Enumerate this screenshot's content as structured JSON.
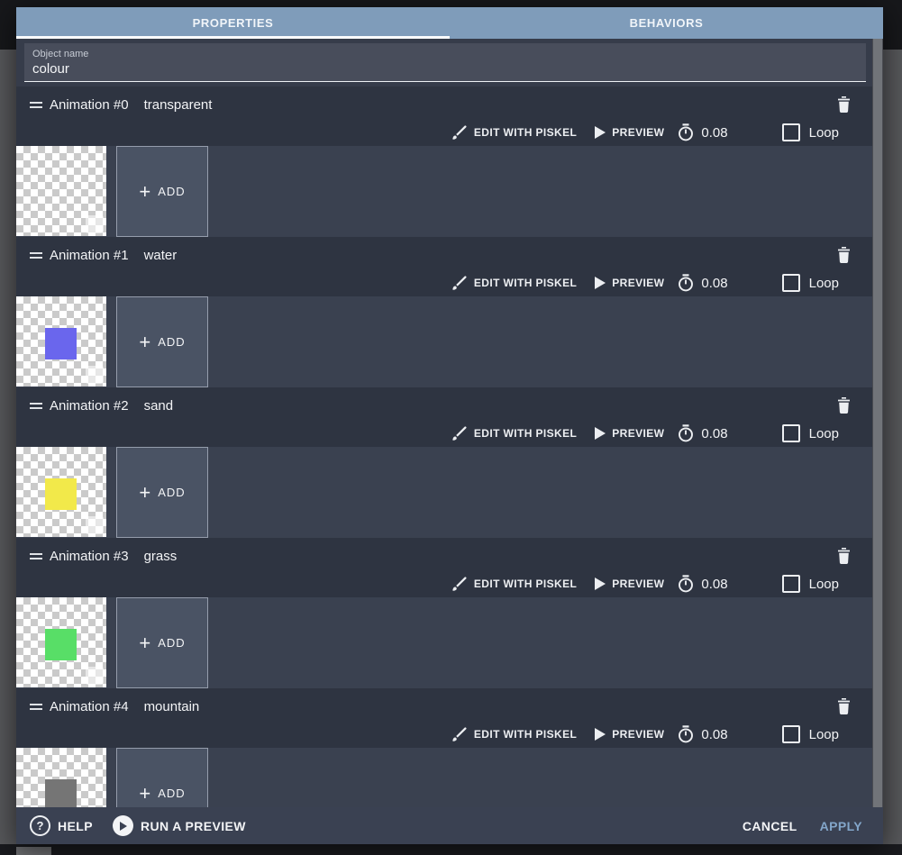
{
  "tabs": [
    {
      "label": "PROPERTIES",
      "active": true
    },
    {
      "label": "BEHAVIORS",
      "active": false
    }
  ],
  "object_name": {
    "label": "Object name",
    "value": "colour"
  },
  "action_labels": {
    "edit": "EDIT WITH PISKEL",
    "preview": "PREVIEW",
    "loop": "Loop",
    "add": "ADD"
  },
  "icons": {
    "plus": "+",
    "help": "?"
  },
  "animations": [
    {
      "title": "Animation #0",
      "name": "transparent",
      "time": "0.08",
      "loop": false,
      "swatch": ""
    },
    {
      "title": "Animation #1",
      "name": "water",
      "time": "0.08",
      "loop": false,
      "swatch": "#6a66ed"
    },
    {
      "title": "Animation #2",
      "name": "sand",
      "time": "0.08",
      "loop": false,
      "swatch": "#f2e94a"
    },
    {
      "title": "Animation #3",
      "name": "grass",
      "time": "0.08",
      "loop": false,
      "swatch": "#58de67"
    },
    {
      "title": "Animation #4",
      "name": "mountain",
      "time": "0.08",
      "loop": false,
      "swatch": "#757575"
    }
  ],
  "footer": {
    "help": "HELP",
    "run_preview": "RUN A PREVIEW",
    "cancel": "CANCEL",
    "apply": "APPLY"
  },
  "colors": {
    "tab_bar": "#7f9cba",
    "dialog_body": "#363c4a",
    "row_header": "#2e3441",
    "frame_strip": "#3a4150",
    "apply_accent": "#83a6ca",
    "checker_light": "#ffffff",
    "checker_dark": "#cacaca"
  }
}
